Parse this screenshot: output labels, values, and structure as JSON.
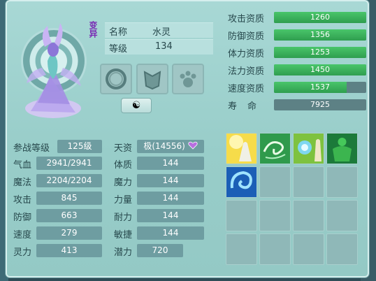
{
  "pet": {
    "title": "变异",
    "name_label": "名称",
    "name": "水灵",
    "level_label": "等级",
    "level": "134"
  },
  "aptitudes": [
    {
      "label": "攻击资质",
      "value": "1260",
      "fill": 1.0
    },
    {
      "label": "防御资质",
      "value": "1356",
      "fill": 1.0
    },
    {
      "label": "体力资质",
      "value": "1253",
      "fill": 1.0
    },
    {
      "label": "法力资质",
      "value": "1450",
      "fill": 1.0
    },
    {
      "label": "速度资质",
      "value": "1537",
      "fill": 0.79
    }
  ],
  "lifespan": {
    "label": "寿　命",
    "value": "7925"
  },
  "stats_left": [
    {
      "label": "参战等级",
      "value": "125级"
    },
    {
      "label": "气血",
      "value": "2941/2941"
    },
    {
      "label": "魔法",
      "value": "2204/2204"
    },
    {
      "label": "攻击",
      "value": "845"
    },
    {
      "label": "防御",
      "value": "663"
    },
    {
      "label": "速度",
      "value": "279"
    },
    {
      "label": "灵力",
      "value": "413"
    }
  ],
  "stats_right": [
    {
      "label": "天资",
      "value": "极(14556)"
    },
    {
      "label": "体质",
      "value": "144"
    },
    {
      "label": "魔力",
      "value": "144"
    },
    {
      "label": "力量",
      "value": "144"
    },
    {
      "label": "耐力",
      "value": "144"
    },
    {
      "label": "敏捷",
      "value": "144"
    },
    {
      "label": "潜力",
      "value": "720"
    }
  ],
  "buttons": {
    "yin_yang": "☯"
  },
  "colors": {
    "bar_green": "#3bb35b",
    "heart": "#b76fe0"
  }
}
